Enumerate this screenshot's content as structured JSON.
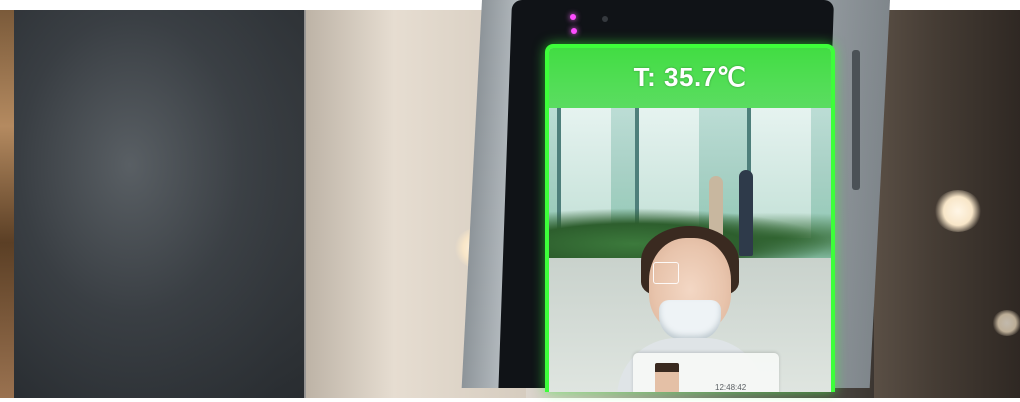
{
  "screen": {
    "temperature": "T: 35.7℃",
    "record_time": "12:48:42"
  },
  "icons": {
    "sensor": "sensor-light-icon",
    "camera": "camera-lens-icon",
    "face_detect": "face-detection-box-icon"
  },
  "colors": {
    "screen_border": "#3dff3a",
    "temperature_bar": "#3adc3a",
    "sensor_light": "#ff4cff"
  }
}
